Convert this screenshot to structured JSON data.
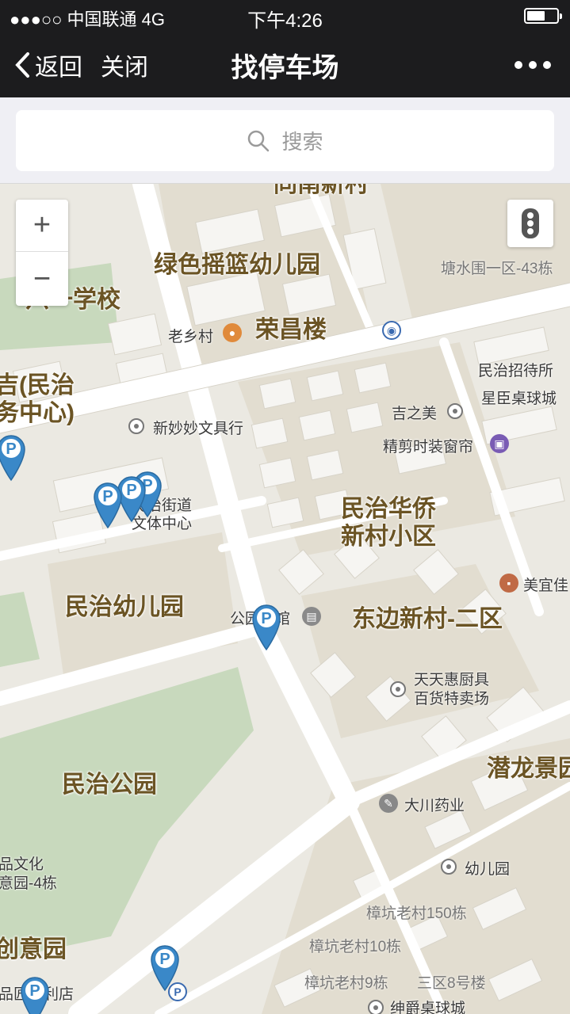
{
  "status_bar": {
    "carrier": "●●●○○ 中国联通   4G",
    "time": "下午4:26",
    "battery_level": 0.6
  },
  "nav": {
    "back_label": "返回",
    "close_label": "关闭",
    "title": "找停车场"
  },
  "search": {
    "placeholder": "搜索"
  },
  "map": {
    "zoom_in": "+",
    "zoom_out": "−",
    "labels": {
      "top_cut": "同南新村",
      "tangshuiwei": "塘水围一区-43栋",
      "lvse": "绿色摇篮幼儿园",
      "liuyi": "六一学校",
      "laoxiangcun": "老乡村",
      "rongchang": "荣昌楼",
      "minzhi_zhaodai": "民治招待所",
      "xingchen": "星臣桌球城",
      "minzhi_service": "吉(民治\n务中心)",
      "jizhimei": "吉之美",
      "xinmiaomiao": "新妙妙文具行",
      "jingjian": "精剪时装窗帘",
      "minzhi_jiedao": "民治街道\n文体中心",
      "huaqiao": "民治华侨\n新村小区",
      "meiyijia": "美宜佳",
      "minzhi_kindergarten": "民治幼儿园",
      "gongyuan_kuguan": "公园宾馆",
      "dongbian": "东边新村-二区",
      "tiantianhui": "天天惠厨具\n百货特卖场",
      "qianlong": "潜龙景园",
      "minzhi_park": "民治公园",
      "dachuan": "大川药业",
      "youeryuan": "幼儿园",
      "wenhua_4": "品文化\n意园-4栋",
      "zhangkeng150": "樟坑老村150栋",
      "zhangkeng10": "樟坑老村10栋",
      "chuangyiyuan": "创意园",
      "zhangkeng9": "樟坑老村9栋",
      "sanqu8": "三区8号楼",
      "pinjia": "品匠佳利店",
      "shenjue": "绅爵桌球城"
    },
    "parking_badge": "P",
    "colors": {
      "pin": "#3a88c8",
      "park": "#c8d9bd",
      "road": "#ffffff",
      "block": "#ddd9cf",
      "building": "#f6f5f2",
      "label": "#6b5424"
    }
  }
}
